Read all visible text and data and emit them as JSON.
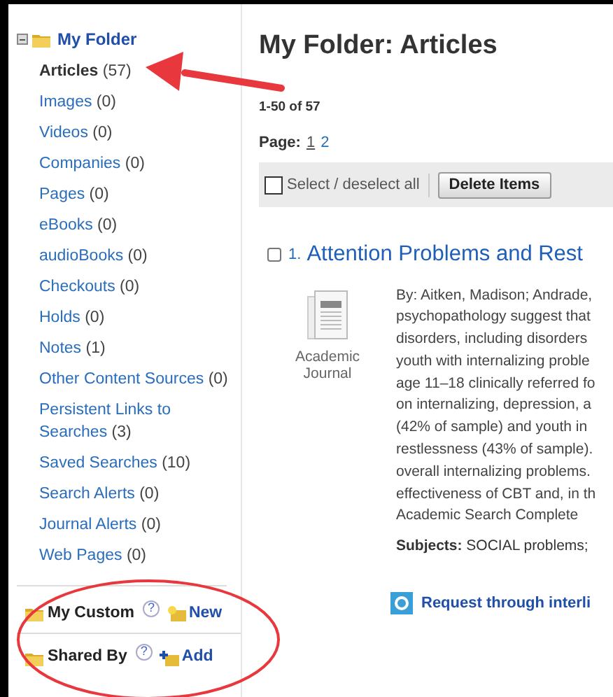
{
  "sidebar": {
    "folder": {
      "label": "My Folder",
      "expanded": true
    },
    "items": [
      {
        "label": "Articles",
        "count": "(57)",
        "selected": true
      },
      {
        "label": "Images",
        "count": "(0)",
        "selected": false
      },
      {
        "label": "Videos",
        "count": "(0)",
        "selected": false
      },
      {
        "label": "Companies",
        "count": "(0)",
        "selected": false
      },
      {
        "label": "Pages",
        "count": "(0)",
        "selected": false
      },
      {
        "label": "eBooks",
        "count": "(0)",
        "selected": false
      },
      {
        "label": "audioBooks",
        "count": "(0)",
        "selected": false
      },
      {
        "label": "Checkouts",
        "count": "(0)",
        "selected": false
      },
      {
        "label": "Holds",
        "count": "(0)",
        "selected": false
      },
      {
        "label": "Notes",
        "count": "(1)",
        "selected": false
      },
      {
        "label": "Other Content Sources",
        "count": "(0)",
        "selected": false
      },
      {
        "label": "Persistent Links to Searches",
        "count": "(3)",
        "selected": false
      },
      {
        "label": "Saved Searches",
        "count": "(10)",
        "selected": false
      },
      {
        "label": "Search Alerts",
        "count": "(0)",
        "selected": false
      },
      {
        "label": "Journal Alerts",
        "count": "(0)",
        "selected": false
      },
      {
        "label": "Web Pages",
        "count": "(0)",
        "selected": false
      }
    ],
    "sections": [
      {
        "label": "My Custom",
        "help": "?",
        "action": "New",
        "kind": "new"
      },
      {
        "label": "Shared By",
        "help": "?",
        "action": "Add",
        "kind": "add"
      }
    ]
  },
  "main": {
    "title": "My Folder: Articles",
    "range": "1-50 of 57",
    "page_label": "Page:",
    "pages": [
      {
        "label": "1",
        "selected": true
      },
      {
        "label": "2",
        "selected": false
      }
    ],
    "toolbar": {
      "select_all": {
        "label": "Select / deselect all",
        "checked": false
      },
      "delete_button": "Delete Items"
    },
    "results": [
      {
        "number": "1.",
        "title": "Attention Problems and Rest",
        "checked": false,
        "type": "Academic Journal",
        "abstract_lines": [
          "By: Aitken, Madison; Andrade,",
          "psychopathology suggest that",
          "disorders, including disorders",
          "youth with internalizing proble",
          "age 11–18 clinically referred fo",
          "on internalizing, depression, a",
          "(42% of sample) and youth in",
          "restlessness (43% of sample).",
          "overall internalizing problems.",
          "effectiveness of CBT and, in th",
          "Academic Search Complete"
        ],
        "subjects_label": "Subjects:",
        "subjects": "SOCIAL problems;",
        "request_link": "Request through interli"
      }
    ]
  }
}
